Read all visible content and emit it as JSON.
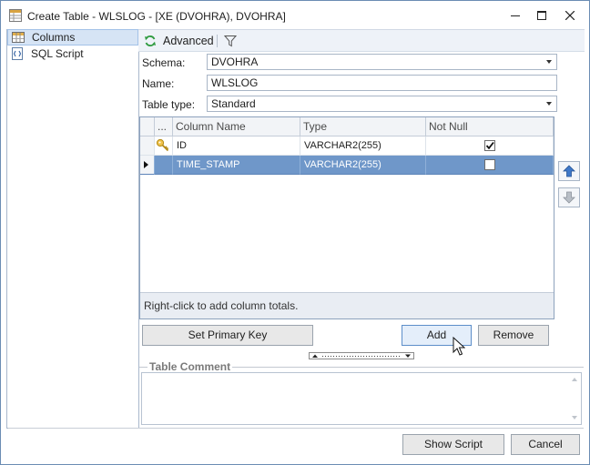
{
  "window": {
    "title": "Create Table - WLSLOG - [XE (DVOHRA), DVOHRA]"
  },
  "sidebar": {
    "items": [
      {
        "label": "Columns",
        "icon": "columns-icon",
        "selected": true
      },
      {
        "label": "SQL Script",
        "icon": "sql-script-icon",
        "selected": false
      }
    ]
  },
  "toolbar": {
    "advanced_label": "Advanced"
  },
  "form": {
    "schema_label": "Schema:",
    "schema_value": "DVOHRA",
    "name_label": "Name:",
    "name_value": "WLSLOG",
    "table_type_label": "Table type:",
    "table_type_value": "Standard"
  },
  "grid": {
    "headers": [
      "...",
      "Column Name",
      "Type",
      "Not Null"
    ],
    "rows": [
      {
        "name": "ID",
        "type": "VARCHAR2(255)",
        "not_null": true,
        "primary_key": true,
        "selected": false
      },
      {
        "name": "TIME_STAMP",
        "type": "VARCHAR2(255)",
        "not_null": false,
        "primary_key": false,
        "selected": true
      }
    ],
    "footer": "Right-click to add column totals."
  },
  "buttons": {
    "set_primary_key": "Set Primary Key",
    "add": "Add",
    "remove": "Remove",
    "show_script": "Show Script",
    "cancel": "Cancel"
  },
  "comment": {
    "legend": "Table Comment",
    "value": ""
  },
  "colors": {
    "selection": "#6f97c9",
    "accent": "#3f78c8"
  }
}
